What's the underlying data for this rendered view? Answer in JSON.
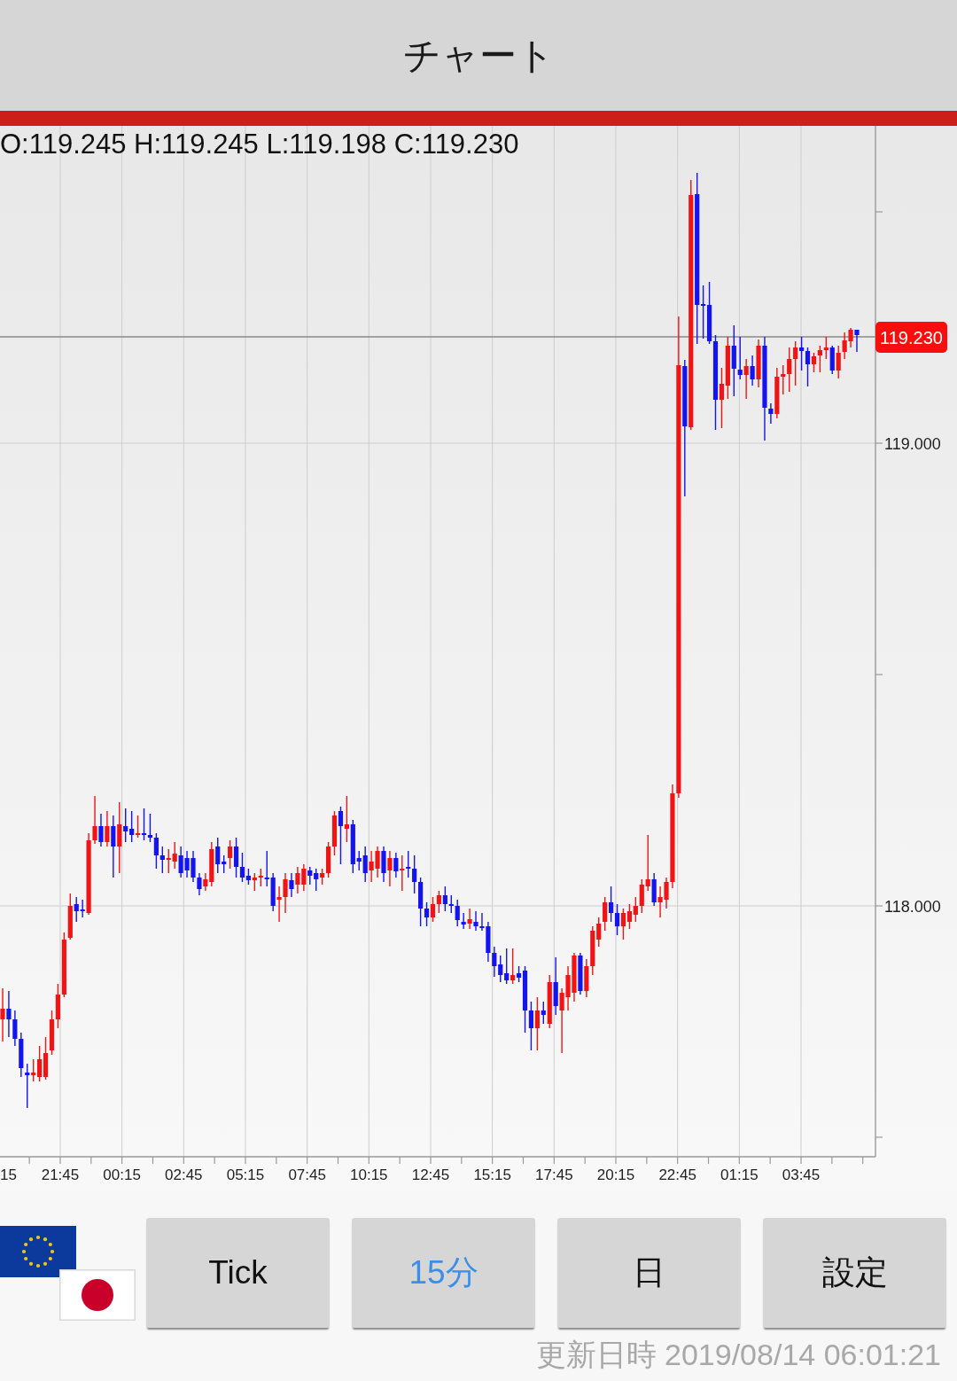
{
  "header": {
    "title": "チャート"
  },
  "chart": {
    "ohlc": "O:119.245 H:119.245 L:119.198 C:119.230",
    "current_price": "119.230",
    "y_axis_labels": [
      "119.000",
      "118.000"
    ],
    "x_axis_labels": [
      "15",
      "21:45",
      "00:15",
      "02:45",
      "05:15",
      "07:45",
      "10:15",
      "12:45",
      "15:15",
      "17:45",
      "20:15",
      "22:45",
      "01:15",
      "03:45"
    ]
  },
  "period_buttons": [
    {
      "label": "Tick",
      "selected": false
    },
    {
      "label": "15分",
      "selected": true
    },
    {
      "label": "日",
      "selected": false
    }
  ],
  "settings_button": {
    "label": "設定"
  },
  "updated_at": "更新日時 2019/08/14 06:01:21"
}
